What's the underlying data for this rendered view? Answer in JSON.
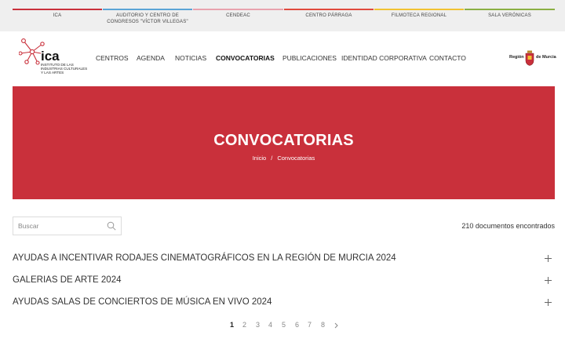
{
  "top_strip": [
    {
      "label": "ICA",
      "color": "#c9303b"
    },
    {
      "label": "AUDITORIO Y CENTRO DE CONGRESOS \"VÍCTOR VILLEGAS\"",
      "color": "#5aa5d6"
    },
    {
      "label": "CENDEAC",
      "color": "#e9a3ae"
    },
    {
      "label": "CENTRO PÁRRAGA",
      "color": "#e04a3e"
    },
    {
      "label": "FILMOTECA REGIONAL",
      "color": "#f1c232"
    },
    {
      "label": "SALA VERÓNICAS",
      "color": "#8bb043"
    }
  ],
  "logo": {
    "name": "ica",
    "subtitle": "INSTITUTO DE LAS INDUSTRIAS CULTURALES Y LAS ARTES"
  },
  "nav": [
    {
      "label": "CENTROS",
      "active": false
    },
    {
      "label": "AGENDA",
      "active": false
    },
    {
      "label": "NOTICIAS",
      "active": false
    },
    {
      "label": "CONVOCATORIAS",
      "active": true
    },
    {
      "label": "PUBLICACIONES",
      "active": false
    },
    {
      "label": "IDENTIDAD CORPORATIVA",
      "active": false
    },
    {
      "label": "CONTACTO",
      "active": false
    }
  ],
  "region": {
    "left": "Región",
    "right": "de Murcia"
  },
  "banner": {
    "title": "CONVOCATORIAS",
    "breadcrumb_home": "Inicio",
    "breadcrumb_sep": "/",
    "breadcrumb_current": "Convocatorias",
    "color": "#c9303b"
  },
  "search": {
    "placeholder": "Buscar",
    "value": ""
  },
  "results_count": "210 documentos encontrados",
  "items": [
    {
      "title": "AYUDAS A INCENTIVAR RODAJES CINEMATOGRÁFICOS EN LA REGIÓN DE MURCIA 2024"
    },
    {
      "title": "GALERIAS DE ARTE 2024"
    },
    {
      "title": "AYUDAS SALAS DE CONCIERTOS DE MÚSICA EN VIVO 2024"
    }
  ],
  "pagination": {
    "pages": [
      "1",
      "2",
      "3",
      "4",
      "5",
      "6",
      "7",
      "8"
    ],
    "current": "1"
  }
}
